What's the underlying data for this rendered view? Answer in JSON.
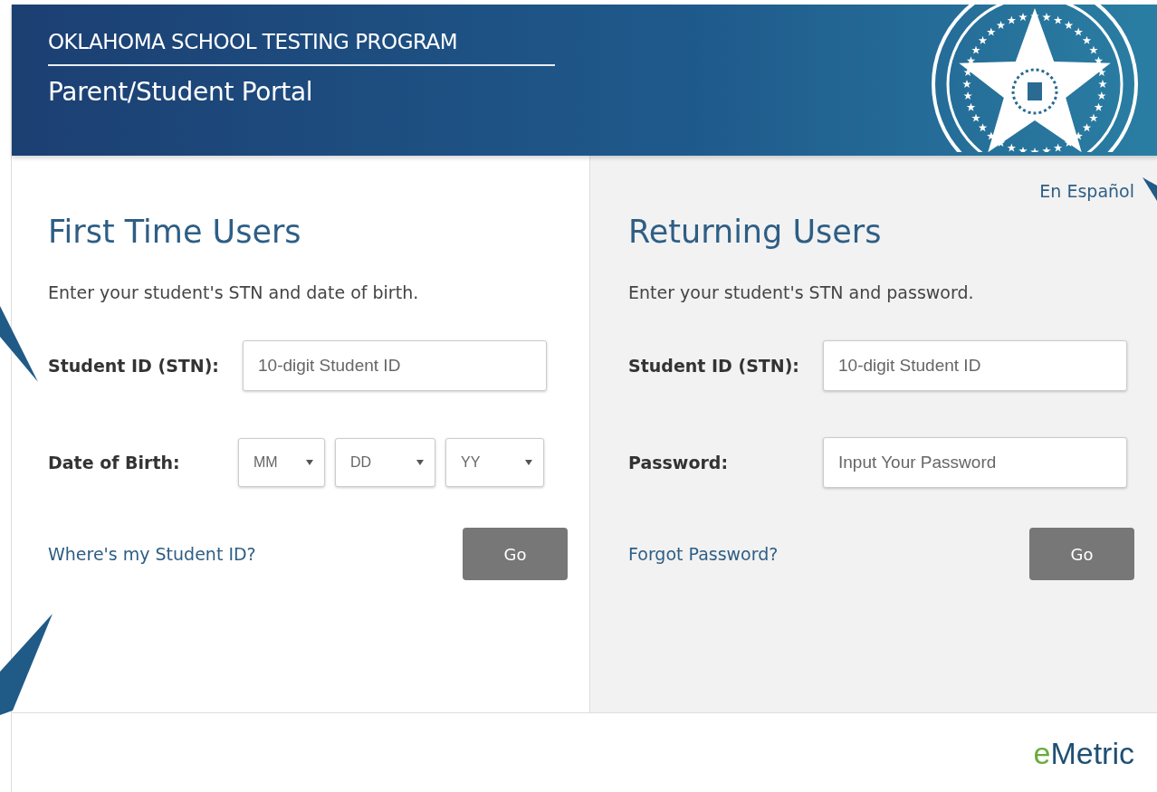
{
  "header": {
    "program": "OKLAHOMA SCHOOL TESTING PROGRAM",
    "portal": "Parent/Student Portal"
  },
  "language_link": "En Español",
  "panels": [
    {
      "title": "First Time Users",
      "instructions": "Enter your student's STN and date of birth.",
      "fields": [
        {
          "kind": "text",
          "label": "Student ID (STN):",
          "placeholder": "10-digit Student ID"
        },
        {
          "kind": "date",
          "label": "Date of Birth:",
          "selects": [
            "MM",
            "DD",
            "YY"
          ]
        }
      ],
      "help_link": "Where's my Student ID?",
      "button": "Go"
    },
    {
      "title": "Returning Users",
      "instructions": "Enter your student's STN and password.",
      "fields": [
        {
          "kind": "text",
          "label": "Student ID (STN):",
          "placeholder": "10-digit Student ID"
        },
        {
          "kind": "password",
          "label": "Password:",
          "placeholder": "Input Your Password"
        }
      ],
      "help_link": "Forgot Password?",
      "button": "Go"
    }
  ],
  "logo": {
    "part_1": "e",
    "part_2": "Metric"
  }
}
